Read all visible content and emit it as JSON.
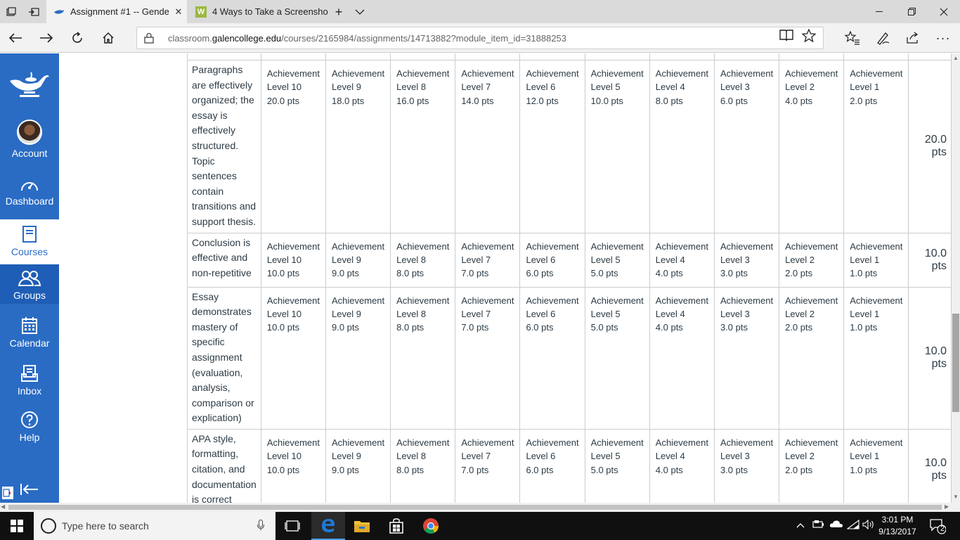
{
  "browser": {
    "tabs": [
      {
        "title": "Assignment #1 -- Gende",
        "active": true
      },
      {
        "title": "4 Ways to Take a Screensho",
        "active": false
      }
    ],
    "url_prefix": "classroom.",
    "url_domain": "galencollege.edu",
    "url_path": "/courses/2165984/assignments/14713882?module_item_id=31888253"
  },
  "sidebar": {
    "items": [
      {
        "label": "Account",
        "icon": "avatar"
      },
      {
        "label": "Dashboard",
        "icon": "dashboard-icon"
      },
      {
        "label": "Courses",
        "icon": "courses-icon"
      },
      {
        "label": "Groups",
        "icon": "groups-icon"
      },
      {
        "label": "Calendar",
        "icon": "calendar-icon"
      },
      {
        "label": "Inbox",
        "icon": "inbox-icon"
      },
      {
        "label": "Help",
        "icon": "help-icon"
      }
    ]
  },
  "rubric": {
    "rows": [
      {
        "criterion": "Paragraphs are effectively organized; the essay is effectively structured. Topic sentences contain transitions and support thesis.",
        "ratings": [
          {
            "l1": "Achievement",
            "l2": "Level 10",
            "pts": "20.0 pts"
          },
          {
            "l1": "Achievement",
            "l2": "Level 9",
            "pts": "18.0 pts"
          },
          {
            "l1": "Achievement",
            "l2": "Level 8",
            "pts": "16.0 pts"
          },
          {
            "l1": "Achievement",
            "l2": "Level 7",
            "pts": "14.0 pts"
          },
          {
            "l1": "Achievement",
            "l2": "Level 6",
            "pts": "12.0 pts"
          },
          {
            "l1": "Achievement",
            "l2": "Level 5",
            "pts": "10.0 pts"
          },
          {
            "l1": "Achievement",
            "l2": "Level 4",
            "pts": "8.0 pts"
          },
          {
            "l1": "Achievement",
            "l2": "Level 3",
            "pts": "6.0 pts"
          },
          {
            "l1": "Achievement",
            "l2": "Level 2",
            "pts": "4.0 pts"
          },
          {
            "l1": "Achievement",
            "l2": "Level 1",
            "pts": "2.0 pts"
          }
        ],
        "total": "20.0 pts"
      },
      {
        "criterion": "Conclusion is effective and non-repetitive",
        "ratings": [
          {
            "l1": "Achievement",
            "l2": "Level 10",
            "pts": "10.0 pts"
          },
          {
            "l1": "Achievement",
            "l2": "Level 9",
            "pts": "9.0 pts"
          },
          {
            "l1": "Achievement",
            "l2": "Level 8",
            "pts": "8.0 pts"
          },
          {
            "l1": "Achievement",
            "l2": "Level 7",
            "pts": "7.0 pts"
          },
          {
            "l1": "Achievement",
            "l2": "Level 6",
            "pts": "6.0 pts"
          },
          {
            "l1": "Achievement",
            "l2": "Level 5",
            "pts": "5.0 pts"
          },
          {
            "l1": "Achievement",
            "l2": "Level 4",
            "pts": "4.0 pts"
          },
          {
            "l1": "Achievement",
            "l2": "Level 3",
            "pts": "3.0 pts"
          },
          {
            "l1": "Achievement",
            "l2": "Level 2",
            "pts": "2.0 pts"
          },
          {
            "l1": "Achievement",
            "l2": "Level 1",
            "pts": "1.0 pts"
          }
        ],
        "total": "10.0 pts"
      },
      {
        "criterion": "Essay demonstrates mastery of specific assignment (evaluation, analysis, comparison or explication)",
        "ratings": [
          {
            "l1": "Achievement",
            "l2": "Level 10",
            "pts": "10.0 pts"
          },
          {
            "l1": "Achievement",
            "l2": "Level 9",
            "pts": "9.0 pts"
          },
          {
            "l1": "Achievement",
            "l2": "Level 8",
            "pts": "8.0 pts"
          },
          {
            "l1": "Achievement",
            "l2": "Level 7",
            "pts": "7.0 pts"
          },
          {
            "l1": "Achievement",
            "l2": "Level 6",
            "pts": "6.0 pts"
          },
          {
            "l1": "Achievement",
            "l2": "Level 5",
            "pts": "5.0 pts"
          },
          {
            "l1": "Achievement",
            "l2": "Level 4",
            "pts": "4.0 pts"
          },
          {
            "l1": "Achievement",
            "l2": "Level 3",
            "pts": "3.0 pts"
          },
          {
            "l1": "Achievement",
            "l2": "Level 2",
            "pts": "2.0 pts"
          },
          {
            "l1": "Achievement",
            "l2": "Level 1",
            "pts": "1.0 pts"
          }
        ],
        "total": "10.0 pts"
      },
      {
        "criterion": "APA style, formatting, citation, and documentation is correct",
        "ratings": [
          {
            "l1": "Achievement",
            "l2": "Level 10",
            "pts": "10.0 pts"
          },
          {
            "l1": "Achievement",
            "l2": "Level 9",
            "pts": "9.0 pts"
          },
          {
            "l1": "Achievement",
            "l2": "Level 8",
            "pts": "8.0 pts"
          },
          {
            "l1": "Achievement",
            "l2": "Level 7",
            "pts": "7.0 pts"
          },
          {
            "l1": "Achievement",
            "l2": "Level 6",
            "pts": "6.0 pts"
          },
          {
            "l1": "Achievement",
            "l2": "Level 5",
            "pts": "5.0 pts"
          },
          {
            "l1": "Achievement",
            "l2": "Level 4",
            "pts": "4.0 pts"
          },
          {
            "l1": "Achievement",
            "l2": "Level 3",
            "pts": "3.0 pts"
          },
          {
            "l1": "Achievement",
            "l2": "Level 2",
            "pts": "2.0 pts"
          },
          {
            "l1": "Achievement",
            "l2": "Level 1",
            "pts": "1.0 pts"
          }
        ],
        "total": "10.0 pts"
      }
    ]
  },
  "taskbar": {
    "search_placeholder": "Type here to search",
    "time": "3:01 PM",
    "date": "9/13/2017",
    "notification_count": "2"
  },
  "colors": {
    "sidebar": "#2a6cc4",
    "taskbar": "#101010",
    "edge_accent": "#1e7ad6"
  }
}
